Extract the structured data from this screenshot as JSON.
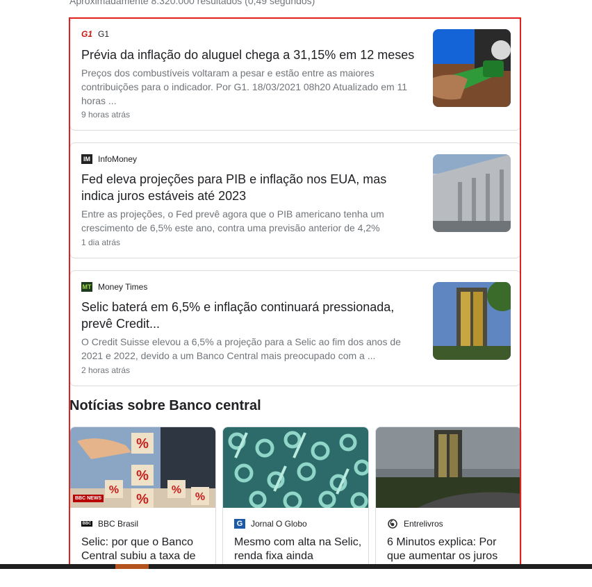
{
  "results_count": "Aproximadamente 8.320.000 resultados (0,49 segundos)",
  "news": [
    {
      "source": "G1",
      "title": "Prévia da inflação do aluguel chega a 31,15% em 12 meses",
      "snippet": "Preços dos combustíveis voltaram a pesar e estão entre as maiores contribuições para o indicador. Por G1. 18/03/2021 08h20 Atualizado em 11 horas ...",
      "time": "9 horas atrás"
    },
    {
      "source": "InfoMoney",
      "title": "Fed eleva projeções para PIB e inflação nos EUA, mas indica juros estáveis até 2023",
      "snippet": "Entre as projeções, o Fed prevê agora que o PIB americano tenha um crescimento de 6,5% este ano, contra uma previsão anterior de 4,2%",
      "time": "1 dia atrás"
    },
    {
      "source": "Money Times",
      "title": "Selic baterá em 6,5% e inflação continuará pressionada, prevê Credit...",
      "snippet": "O Credit Suisse elevou a 6,5% a projeção para a Selic ao fim dos anos de 2021 e 2022, devido a um Banco Central mais preocupado com a ...",
      "time": "2 horas atrás"
    }
  ],
  "section_title": "Notícias sobre Banco central",
  "top_stories": [
    {
      "source": "BBC Brasil",
      "title": "Selic: por que o Banco Central subiu a taxa de",
      "badge": "BBC NEWS"
    },
    {
      "source": "Jornal O Globo",
      "title": "Mesmo com alta na Selic, renda fixa ainda"
    },
    {
      "source": "Entrelivros",
      "title": "6 Minutos explica: Por que aumentar os juros"
    }
  ],
  "logos": {
    "g1": "G1",
    "infomoney": "IM",
    "moneytimes": "MT",
    "bbc": "BBC"
  },
  "colors": {
    "highlight_border": "#e0211c",
    "g1_red": "#c4170c"
  }
}
